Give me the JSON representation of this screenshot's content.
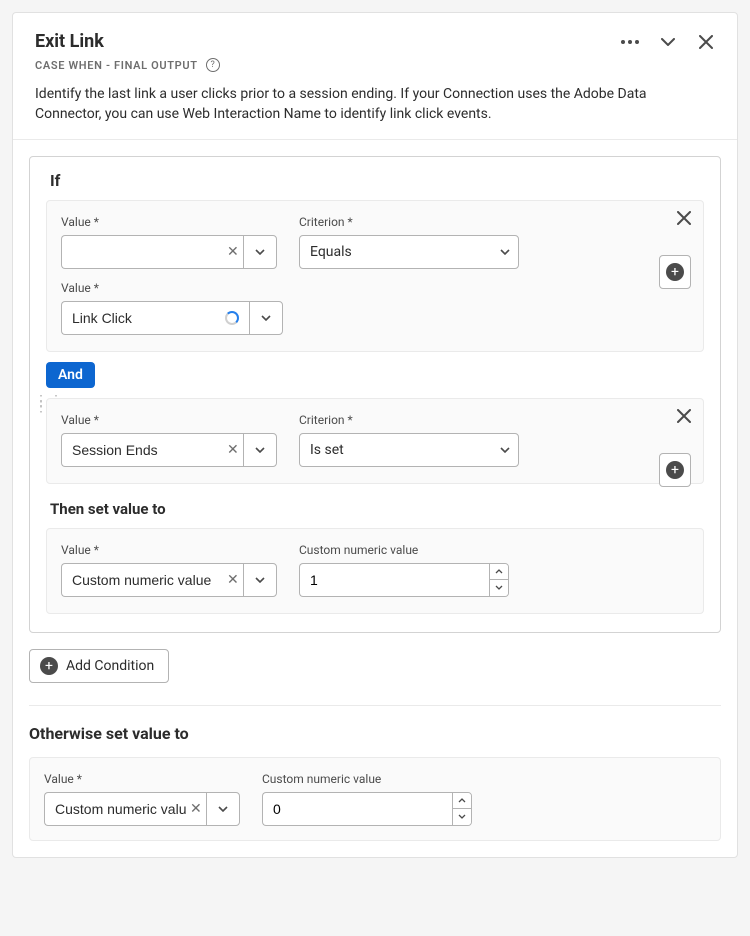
{
  "header": {
    "title": "Exit Link",
    "subtitle": "CASE WHEN - FINAL OUTPUT",
    "description": "Identify the last link a user clicks prior to a session ending. If your Connection uses the Adobe Data Connector, you can use Web Interaction Name to identify link click events."
  },
  "labels": {
    "value": "Value",
    "criterion": "Criterion",
    "custom_numeric": "Custom numeric value",
    "if": "If",
    "and": "And",
    "then": "Then set value to",
    "otherwise": "Otherwise set value to",
    "add_condition": "Add Condition"
  },
  "condition1": {
    "value_top": "",
    "criterion": "Equals",
    "value_bottom": "Link Click"
  },
  "condition2": {
    "value": "Session Ends",
    "criterion": "Is set"
  },
  "then": {
    "value_type": "Custom numeric value",
    "numeric_value": "1"
  },
  "otherwise": {
    "value_type": "Custom numeric value",
    "numeric_value": "0"
  }
}
